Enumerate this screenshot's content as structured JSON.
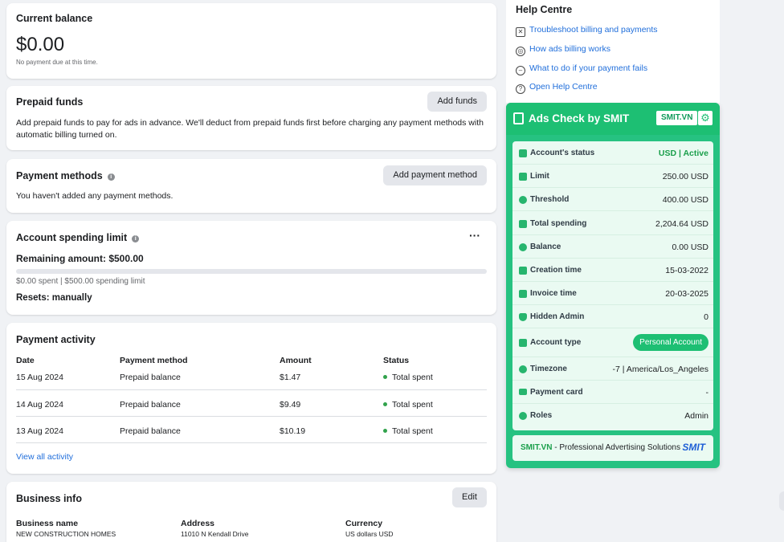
{
  "balance": {
    "title": "Current balance",
    "amount": "$0.00",
    "note": "No payment due at this time."
  },
  "prepaid": {
    "title": "Prepaid funds",
    "button": "Add funds",
    "desc": "Add prepaid funds to pay for ads in advance. We'll deduct from prepaid funds first before charging any payment methods with automatic billing turned on."
  },
  "payment_methods": {
    "title": "Payment methods",
    "button": "Add payment method",
    "desc": "You haven't added any payment methods."
  },
  "spending_limit": {
    "title": "Account spending limit",
    "more": "···",
    "remaining": "Remaining amount: $500.00",
    "progress": 0,
    "spent_text": "$0.00 spent | $500.00 spending limit",
    "resets": "Resets: manually"
  },
  "activity": {
    "title": "Payment activity",
    "columns": [
      "Date",
      "Payment method",
      "Amount",
      "Status"
    ],
    "rows": [
      {
        "date": "15 Aug 2024",
        "method": "Prepaid balance",
        "amount": "$1.47",
        "status": "Total spent"
      },
      {
        "date": "14 Aug 2024",
        "method": "Prepaid balance",
        "amount": "$9.49",
        "status": "Total spent"
      },
      {
        "date": "13 Aug 2024",
        "method": "Prepaid balance",
        "amount": "$10.19",
        "status": "Total spent"
      }
    ],
    "view_all": "View all activity"
  },
  "business": {
    "title": "Business info",
    "button": "Edit",
    "name_label": "Business name",
    "name_value": "NEW CONSTRUCTION HOMES",
    "address_label": "Address",
    "address_value": "11010 N Kendall Drive",
    "currency_label": "Currency",
    "currency_value": "US dollars USD"
  },
  "help": {
    "title": "Help Centre",
    "links": [
      {
        "label": "Troubleshoot billing and payments",
        "icon": "tools-icon"
      },
      {
        "label": "How ads billing works",
        "icon": "globe-icon"
      },
      {
        "label": "What to do if your payment fails",
        "icon": "minus-circle-icon"
      },
      {
        "label": "Open Help Centre",
        "icon": "question-icon"
      }
    ]
  },
  "smit": {
    "title": "Ads Check by SMIT",
    "badge": "SMIT.VN",
    "rows": [
      {
        "label": "Account's status",
        "value": "USD | Active"
      },
      {
        "label": "Limit",
        "value": "250.00 USD"
      },
      {
        "label": "Threshold",
        "value": "400.00 USD"
      },
      {
        "label": "Total spending",
        "value": "2,204.64 USD"
      },
      {
        "label": "Balance",
        "value": "0.00 USD"
      },
      {
        "label": "Creation time",
        "value": "15-03-2022"
      },
      {
        "label": "Invoice time",
        "value": "20-03-2025"
      },
      {
        "label": "Hidden Admin",
        "value": "0"
      },
      {
        "label": "Account type",
        "value": "Personal Account"
      },
      {
        "label": "Timezone",
        "value": "-7 | America/Los_Angeles"
      },
      {
        "label": "Payment card",
        "value": "-"
      },
      {
        "label": "Roles",
        "value": "Admin"
      }
    ],
    "footer_brand": "SMIT.VN",
    "footer_text": " - Professional Advertising Solutions",
    "footer_logo": "SMIT",
    "accent": "#1dbf73"
  }
}
